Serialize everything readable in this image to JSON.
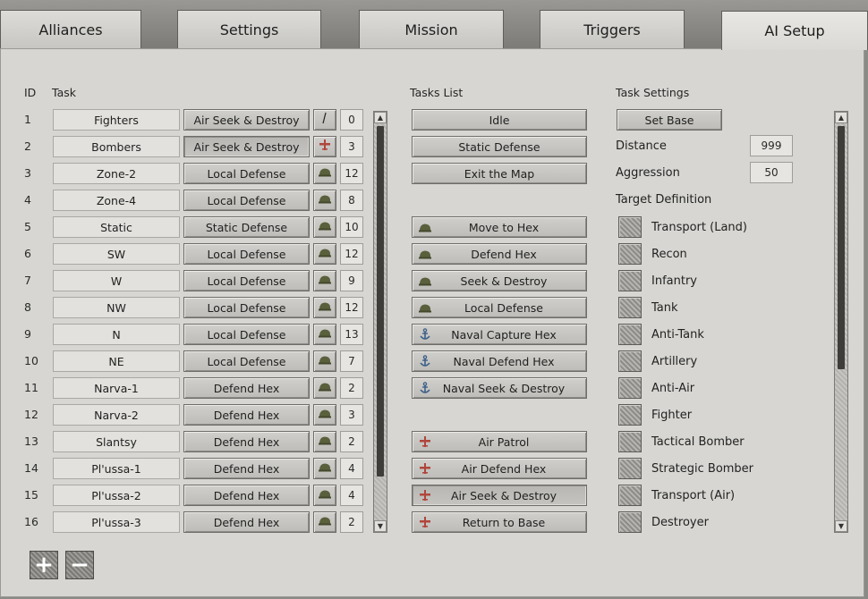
{
  "tabs": [
    {
      "label": "Alliances"
    },
    {
      "label": "Settings"
    },
    {
      "label": "Mission"
    },
    {
      "label": "Triggers"
    },
    {
      "label": "AI Setup"
    }
  ],
  "headers": {
    "id": "ID",
    "task": "Task",
    "tasks_list": "Tasks List",
    "task_settings": "Task Settings"
  },
  "tasks": [
    {
      "id": "1",
      "name": "Fighters",
      "type": "Air Seek & Destroy",
      "icon": "flag-icon",
      "count": "0"
    },
    {
      "id": "2",
      "name": "Bombers",
      "type": "Air Seek & Destroy",
      "icon": "aircraft-icon",
      "count": "3"
    },
    {
      "id": "3",
      "name": "Zone-2",
      "type": "Local Defense",
      "icon": "helmet-icon",
      "count": "12"
    },
    {
      "id": "4",
      "name": "Zone-4",
      "type": "Local Defense",
      "icon": "helmet-icon",
      "count": "8"
    },
    {
      "id": "5",
      "name": "Static",
      "type": "Static Defense",
      "icon": "helmet-icon",
      "count": "10"
    },
    {
      "id": "6",
      "name": "SW",
      "type": "Local Defense",
      "icon": "helmet-icon",
      "count": "12"
    },
    {
      "id": "7",
      "name": "W",
      "type": "Local Defense",
      "icon": "helmet-icon",
      "count": "9"
    },
    {
      "id": "8",
      "name": "NW",
      "type": "Local Defense",
      "icon": "helmet-icon",
      "count": "12"
    },
    {
      "id": "9",
      "name": "N",
      "type": "Local Defense",
      "icon": "helmet-icon",
      "count": "13"
    },
    {
      "id": "10",
      "name": "NE",
      "type": "Local Defense",
      "icon": "helmet-icon",
      "count": "7"
    },
    {
      "id": "11",
      "name": "Narva-1",
      "type": "Defend Hex",
      "icon": "helmet-icon",
      "count": "2"
    },
    {
      "id": "12",
      "name": "Narva-2",
      "type": "Defend Hex",
      "icon": "helmet-icon",
      "count": "3"
    },
    {
      "id": "13",
      "name": "Slantsy",
      "type": "Defend Hex",
      "icon": "helmet-icon",
      "count": "2"
    },
    {
      "id": "14",
      "name": "Pl'ussa-1",
      "type": "Defend Hex",
      "icon": "helmet-icon",
      "count": "4"
    },
    {
      "id": "15",
      "name": "Pl'ussa-2",
      "type": "Defend Hex",
      "icon": "helmet-icon",
      "count": "4"
    },
    {
      "id": "16",
      "name": "Pl'ussa-3",
      "type": "Defend Hex",
      "icon": "helmet-icon",
      "count": "2"
    }
  ],
  "tasks_list": [
    {
      "label": "Idle",
      "icon": ""
    },
    {
      "label": "Static Defense",
      "icon": ""
    },
    {
      "label": "Exit the Map",
      "icon": ""
    },
    {
      "label": "Move to Hex",
      "icon": "helmet-icon"
    },
    {
      "label": "Defend Hex",
      "icon": "helmet-icon"
    },
    {
      "label": "Seek & Destroy",
      "icon": "helmet-icon"
    },
    {
      "label": "Local Defense",
      "icon": "helmet-icon"
    },
    {
      "label": "Naval Capture Hex",
      "icon": "anchor-icon"
    },
    {
      "label": "Naval Defend Hex",
      "icon": "anchor-icon"
    },
    {
      "label": "Naval Seek & Destroy",
      "icon": "anchor-icon"
    },
    {
      "label": "Air Patrol",
      "icon": "aircraft-icon"
    },
    {
      "label": "Air Defend Hex",
      "icon": "aircraft-icon"
    },
    {
      "label": "Air Seek & Destroy",
      "icon": "aircraft-icon",
      "selected": true
    },
    {
      "label": "Return to Base",
      "icon": "aircraft-icon"
    }
  ],
  "settings": {
    "set_base": "Set Base",
    "distance_label": "Distance",
    "distance_value": "999",
    "aggression_label": "Aggression",
    "aggression_value": "50",
    "target_definition_label": "Target Definition"
  },
  "targets": [
    {
      "label": "Transport (Land)"
    },
    {
      "label": "Recon"
    },
    {
      "label": "Infantry"
    },
    {
      "label": "Tank"
    },
    {
      "label": "Anti-Tank"
    },
    {
      "label": "Artillery"
    },
    {
      "label": "Anti-Air"
    },
    {
      "label": "Fighter"
    },
    {
      "label": "Tactical Bomber"
    },
    {
      "label": "Strategic Bomber"
    },
    {
      "label": "Transport (Air)"
    },
    {
      "label": "Destroyer"
    }
  ],
  "scroll_arrows": {
    "up": "▲",
    "down": "▼"
  },
  "bottom_buttons": {
    "add": "+",
    "remove": "−"
  },
  "colors": {
    "helmet": "#5a5f3c",
    "aircraft": "#b0463c",
    "anchor": "#3b5f8a",
    "flag": "#2a2a2a"
  }
}
